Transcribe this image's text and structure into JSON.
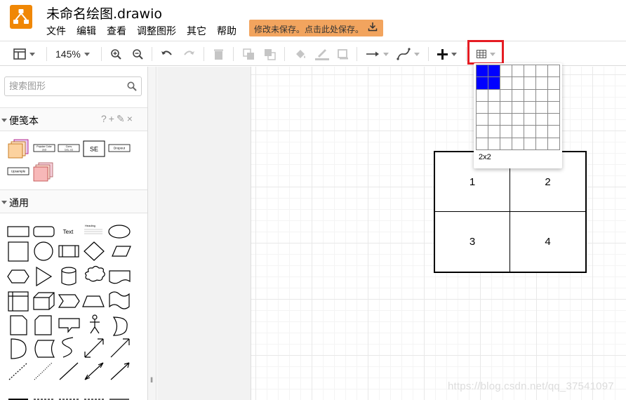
{
  "app": {
    "title": "未命名绘图.drawio",
    "menu": [
      "文件",
      "编辑",
      "查看",
      "调整图形",
      "其它",
      "帮助"
    ],
    "save_notice": "修改未保存。点击此处保存。",
    "colors": {
      "logo": "#f08705",
      "save_notice_bg": "#f2a45e",
      "highlight_box": "#e51c23",
      "picker_selected": "#0000ff"
    }
  },
  "toolbar": {
    "zoom": "145%",
    "icons": [
      "format-panel-icon",
      "zoom-in-icon",
      "zoom-out-icon",
      "undo-icon",
      "redo-icon",
      "delete-icon",
      "to-front-icon",
      "to-back-icon",
      "fill-color-icon",
      "line-color-icon",
      "shadow-icon",
      "connection-icon",
      "waypoints-icon",
      "insert-icon",
      "table-icon"
    ]
  },
  "sidebar": {
    "search_placeholder": "搜索图形",
    "scratchpad": {
      "title": "便笺本",
      "tools": [
        "?",
        "+",
        "✎",
        "×"
      ],
      "items": [
        "Popular Color 2x3",
        "Conv 1x1, s1",
        "SE",
        "Dropout",
        "Upsample"
      ]
    },
    "general": {
      "title": "通用",
      "shape_labels": [
        "Text",
        "Heading"
      ]
    }
  },
  "canvas": {
    "table_cells": [
      "1",
      "2",
      "3",
      "4"
    ]
  },
  "table_picker": {
    "rows": 7,
    "cols": 7,
    "selected_rows": 2,
    "selected_cols": 2,
    "label": "2x2"
  },
  "watermark": "https://blog.csdn.net/qq_37541097"
}
